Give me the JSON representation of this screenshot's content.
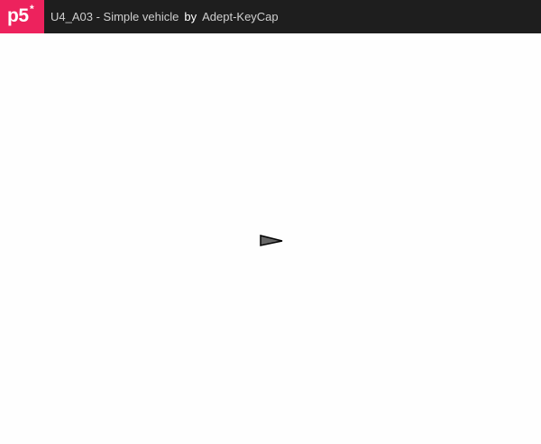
{
  "header": {
    "logo_text": "p5",
    "logo_star": "*",
    "sketch_title": "U4_A03 - Simple vehicle",
    "by_label": "by",
    "author": "Adept-KeyCap"
  },
  "colors": {
    "header_bg": "#1e1e1e",
    "logo_bg": "#ed225d",
    "vehicle_fill": "#666666",
    "vehicle_stroke": "#000000"
  },
  "canvas": {
    "vehicle_icon": "triangle-arrow-icon",
    "vehicle_heading": "right"
  }
}
